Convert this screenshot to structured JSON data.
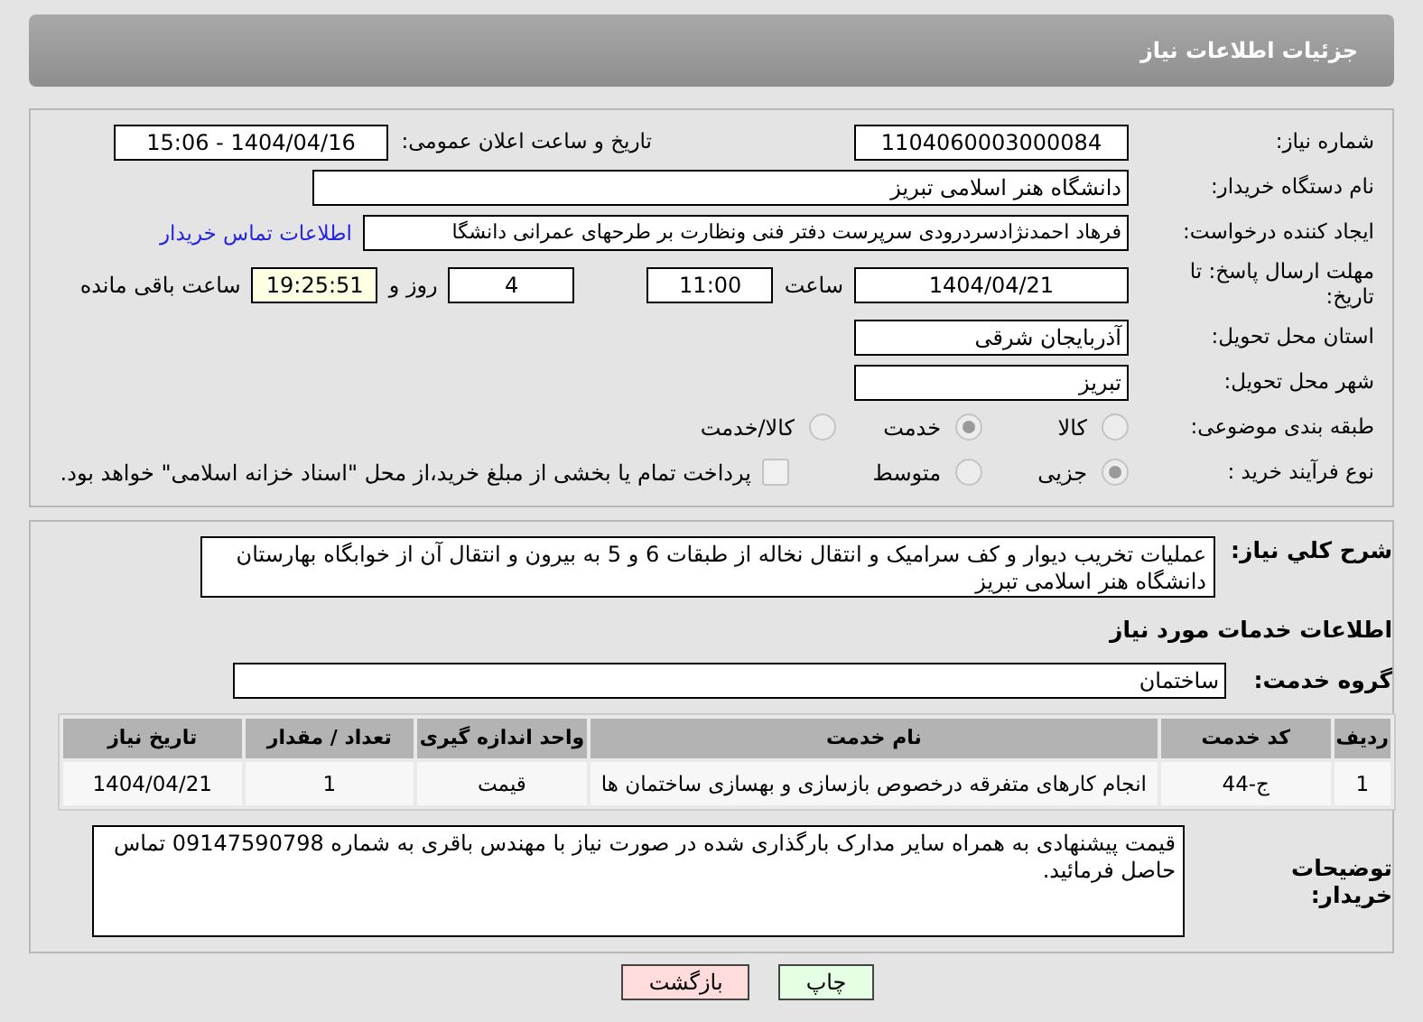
{
  "header": {
    "title": "جزئیات اطلاعات نیاز"
  },
  "details": {
    "need_number": {
      "label": "شماره نیاز:",
      "value": "1104060003000084"
    },
    "announce": {
      "label": "تاریخ و ساعت اعلان عمومی:",
      "value": "1404/04/16 - 15:06"
    },
    "buyer": {
      "label": "نام دستگاه خریدار:",
      "value": "دانشگاه هنر اسلامی تبریز"
    },
    "creator": {
      "label": "ایجاد کننده درخواست:",
      "value": "فرهاد احمدنژادسردرودی سرپرست دفتر فنی ونظارت بر طرحهای عمرانی دانشگا",
      "link": "اطلاعات تماس خریدار"
    },
    "deadline": {
      "label": "مهلت ارسال پاسخ: تا تاریخ:",
      "date": "1404/04/21",
      "time_label": "ساعت",
      "time": "11:00",
      "days": "4",
      "days_label": "روز و",
      "remaining": "19:25:51",
      "remaining_label": "ساعت باقی مانده"
    },
    "province": {
      "label": "استان محل تحویل:",
      "value": "آذربایجان شرقی"
    },
    "city": {
      "label": "شهر محل تحویل:",
      "value": "تبریز"
    },
    "category": {
      "label": "طبقه بندی موضوعی:",
      "options": [
        {
          "label": "کالا",
          "selected": false
        },
        {
          "label": "خدمت",
          "selected": true
        },
        {
          "label": "کالا/خدمت",
          "selected": false
        }
      ]
    },
    "process": {
      "label": "نوع فرآیند خرید :",
      "options": [
        {
          "label": "جزیی",
          "selected": true
        },
        {
          "label": "متوسط",
          "selected": false
        }
      ],
      "payment": {
        "label": "پرداخت تمام یا بخشی از مبلغ خرید،از محل \"اسناد خزانه اسلامی\" خواهد بود.",
        "checked": false
      }
    }
  },
  "services": {
    "description": {
      "label": "شرح کلي نياز:",
      "value": "عملیات تخریب دیوار و کف سرامیک و انتقال نخاله از طبقات 6 و 5 به بیرون و انتقال آن از خوابگاه بهارستان دانشگاه هنر اسلامی تبریز"
    },
    "heading": "اطلاعات خدمات مورد نیاز",
    "group": {
      "label": "گروه خدمت:",
      "value": "ساختمان"
    },
    "table": {
      "columns": [
        "ردیف",
        "کد خدمت",
        "نام خدمت",
        "واحد اندازه گیری",
        "تعداد / مقدار",
        "تاریخ نیاز"
      ],
      "rows": [
        [
          "1",
          "ج-44",
          "انجام کارهای متفرقه درخصوص بازسازی و بهسازی ساختمان ها",
          "قیمت",
          "1",
          "1404/04/21"
        ]
      ]
    },
    "notes": {
      "label": "توضیحات خریدار:",
      "value": "قیمت پیشنهادی به همراه سایر مدارک بارگذاری شده در صورت نیاز با مهندس باقری به شماره 09147590798 تماس حاصل فرمائید."
    }
  },
  "buttons": [
    {
      "label": "چاپ",
      "kind": "print"
    },
    {
      "label": "بازگشت",
      "kind": "back"
    }
  ]
}
